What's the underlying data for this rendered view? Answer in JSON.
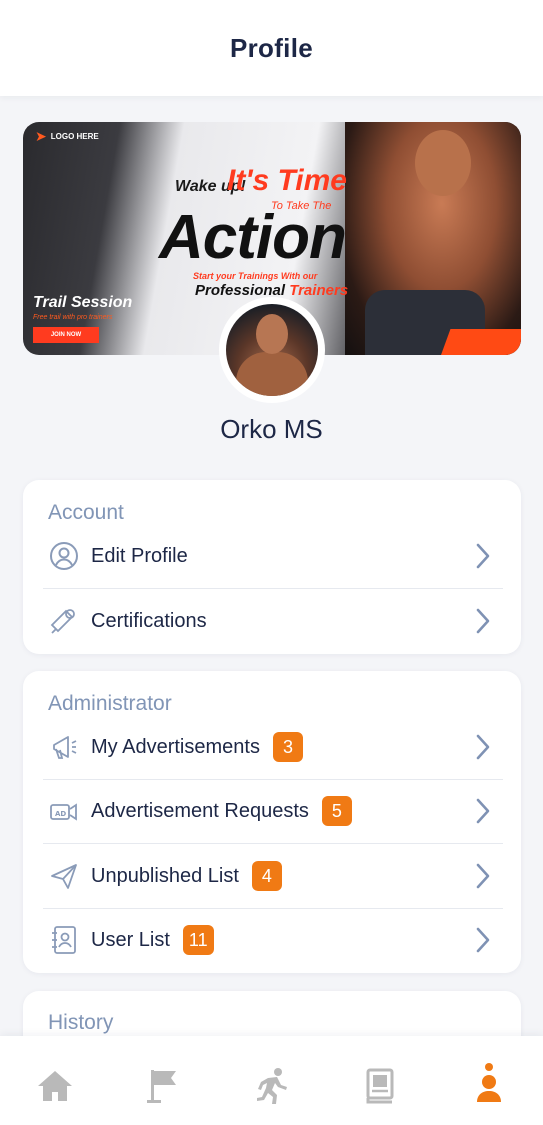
{
  "header": {
    "title": "Profile"
  },
  "banner": {
    "logo": "LOGO HERE",
    "headline_wake": "Wake up!",
    "headline_time": "It's Time",
    "headline_take": "To Take The",
    "headline_action": "Action",
    "subline": "Start your Trainings With our",
    "professional": "Professional",
    "trainers": "Trainers",
    "trail_title": "Trail Session",
    "trail_sub": "Free trail with pro trainers",
    "join_button": "JOIN NOW"
  },
  "profile": {
    "name": "Orko MS"
  },
  "account": {
    "title": "Account",
    "items": [
      {
        "label": "Edit Profile",
        "icon": "user-circle-icon"
      },
      {
        "label": "Certifications",
        "icon": "certificate-icon"
      }
    ]
  },
  "administrator": {
    "title": "Administrator",
    "items": [
      {
        "label": "My Advertisements",
        "badge": "3",
        "icon": "megaphone-icon"
      },
      {
        "label": "Advertisement Requests",
        "badge": "5",
        "icon": "ad-request-icon"
      },
      {
        "label": "Unpublished List",
        "badge": "4",
        "icon": "paper-plane-icon"
      },
      {
        "label": "User List",
        "badge": "11",
        "icon": "contact-book-icon"
      }
    ]
  },
  "history": {
    "title": "History"
  },
  "nav": {
    "items": [
      {
        "icon": "home-icon"
      },
      {
        "icon": "flag-icon"
      },
      {
        "icon": "running-icon"
      },
      {
        "icon": "book-icon"
      },
      {
        "icon": "person-icon",
        "active": true
      }
    ]
  },
  "colors": {
    "accent": "#f07a14",
    "text_primary": "#1d2746",
    "section_title": "#8195b6",
    "icon_muted": "#8a9bb8",
    "nav_inactive": "#b9b9b9"
  }
}
